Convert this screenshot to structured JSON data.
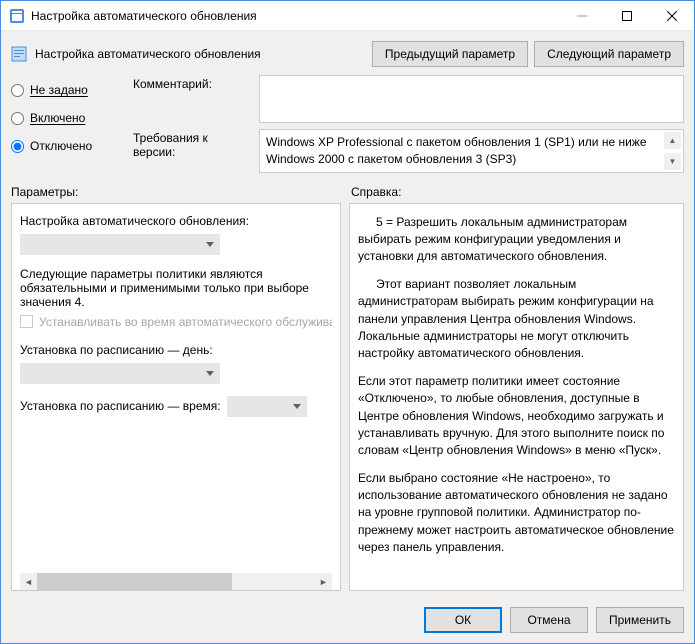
{
  "window": {
    "title": "Настройка автоматического обновления"
  },
  "header": {
    "title": "Настройка автоматического обновления"
  },
  "nav": {
    "prev": "Предыдущий параметр",
    "next": "Следующий параметр"
  },
  "radios": {
    "not_set": "Не задано",
    "enabled": "Включено",
    "disabled": "Отключено",
    "selected": "disabled"
  },
  "fields": {
    "comment_label": "Комментарий:",
    "comment_value": "",
    "requirements_label": "Требования к версии:",
    "requirements_line1": "Windows XP Professional с пакетом обновления 1 (SP1) или не ниже",
    "requirements_line2": "Windows 2000 с пакетом обновления 3 (SP3)"
  },
  "sections": {
    "params": "Параметры:",
    "help": "Справка:"
  },
  "params": {
    "title": "Настройка автоматического обновления:",
    "policy_text": "Следующие параметры политики являются обязательными и применимыми только при выборе значения 4.",
    "checkbox": "Устанавливать во время автоматического обслуживания",
    "day_label": "Установка по расписанию — день:",
    "time_label": "Установка по расписанию — время:"
  },
  "help": {
    "p1": "5 = Разрешить локальным администраторам выбирать режим конфигурации уведомления и установки для автоматического обновления.",
    "p2": "Этот вариант позволяет локальным администраторам выбирать режим конфигурации на панели управления Центра обновления Windows. Локальные администраторы не могут отключить настройку автоматического обновления.",
    "p3": "Если этот параметр политики имеет состояние «Отключено», то любые обновления, доступные в Центре обновления Windows, необходимо загружать и устанавливать вручную. Для этого выполните поиск по словам «Центр обновления Windows» в меню «Пуск».",
    "p4": "Если выбрано состояние «Не настроено», то использование автоматического обновления не задано на уровне групповой политики. Администратор по-прежнему может настроить автоматическое обновление через панель управления."
  },
  "footer": {
    "ok": "ОК",
    "cancel": "Отмена",
    "apply": "Применить"
  }
}
